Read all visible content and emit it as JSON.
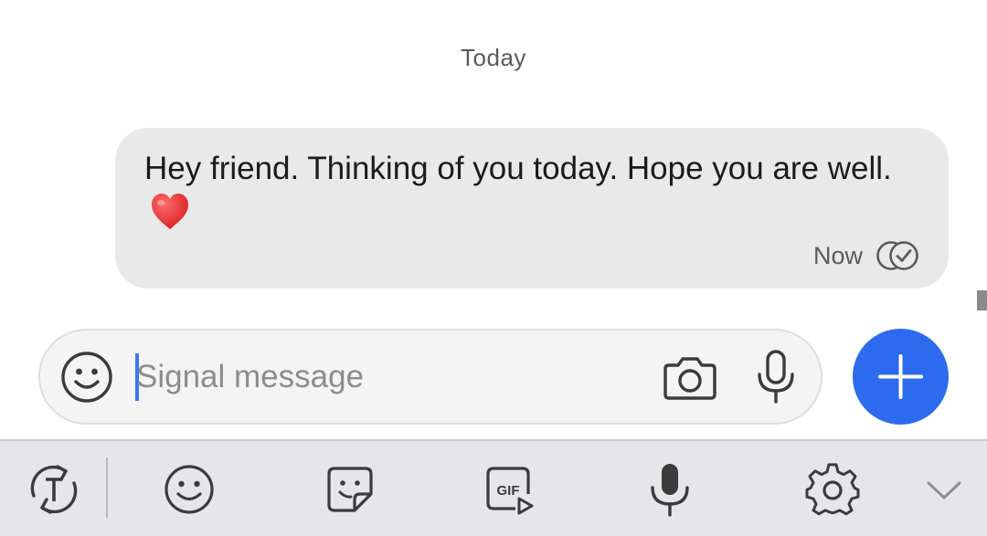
{
  "conversation": {
    "date_divider": "Today",
    "messages": [
      {
        "text": "Hey friend. Thinking of you today. Hope you are well.",
        "emoji_icon": "red-heart-emoji",
        "timestamp": "Now",
        "status_icon": "delivered-double-check-icon",
        "bubble_color": "#e9e9e9"
      }
    ]
  },
  "composer": {
    "placeholder": "Signal message",
    "value": "",
    "emoji_icon": "smiley-icon",
    "camera_icon": "camera-icon",
    "mic_icon": "microphone-icon",
    "attach_icon": "plus-icon",
    "accent_color": "#2c6bed"
  },
  "keyboard_toolbar": {
    "items": [
      {
        "icon": "translate-icon"
      },
      {
        "icon": "emoji-icon"
      },
      {
        "icon": "sticker-icon"
      },
      {
        "icon": "gif-icon",
        "label": "GIF"
      },
      {
        "icon": "voice-input-icon"
      },
      {
        "icon": "settings-icon"
      },
      {
        "icon": "collapse-chevron-icon"
      }
    ],
    "background": "#e6e6ea"
  }
}
